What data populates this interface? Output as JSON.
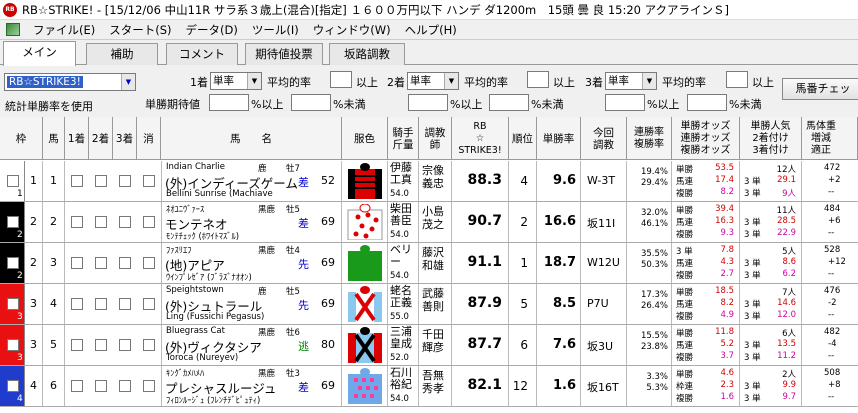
{
  "title": "RB☆STRIKE! - [15/12/06 中山11R サラ系３歳上(混合)[指定] １６００万円以下 ハンデ ダ1200m　15頭 曇 良 15:20 アクアラインＳ]",
  "menu": [
    "ファイル(E)",
    "スタート(S)",
    "データ(D)",
    "ツール(I)",
    "ウィンドウ(W)",
    "ヘルプ(H)"
  ],
  "tabs": [
    "メイン",
    "補助",
    "コメント",
    "期待値投票",
    "坂路調教"
  ],
  "controls": {
    "mode_combo": "RB☆STRIKE3!",
    "stat_label": "統計単勝率を使用",
    "exp_label": "単勝期待値",
    "pct_above": "%以上",
    "pct_below": "%未満",
    "groups": [
      {
        "rank": "1着",
        "type": "単率",
        "avg": "平均的率",
        "cmp": "以上"
      },
      {
        "rank": "2着",
        "type": "単率",
        "avg": "平均的率",
        "cmp": "以上"
      },
      {
        "rank": "3着",
        "type": "単率",
        "avg": "平均的率",
        "cmp": "以上"
      }
    ],
    "side_button": "馬番チェッ"
  },
  "headers": {
    "waku": "枠",
    "uma": "馬",
    "c1": "1着",
    "c2": "2着",
    "c3": "3着",
    "kesu": "消",
    "name": "馬　　名",
    "fuku": "服色",
    "jockey": "騎手\n斤量",
    "trainer": "調教\n師",
    "rb": "RB\n☆\nSTRIKE3!",
    "rank": "順位",
    "odds": "単勝率",
    "training": "今回\n調教",
    "rates": "連勝率\n複勝率",
    "odds_kind": "単勝オッズ\n連勝オッズ\n複勝オッズ",
    "ninki": "単勝人気\n2着付け\n3着付け",
    "weight": "馬体重\n増減\n適正"
  },
  "horses": [
    {
      "waku": "1",
      "uma": "1",
      "sire": "Indian Charlie",
      "sex": "牡7",
      "region": "鹿",
      "name": "(外)インディーズゲーム",
      "style": "差",
      "wt": "52",
      "dam": "Bellini Sunrise (Machiave",
      "jockey": "伊藤\n工真",
      "jkg": "54.0",
      "trainer": "宗像\n義忠",
      "rb": "88.3",
      "rank": "4",
      "tan": "9.6",
      "train": "W-3T",
      "r1": "19.4%",
      "r2": "29.4%",
      "k1": "単勝",
      "k2": "複勝",
      "o1": "53.5",
      "o2": "17.4",
      "o3": "8.2",
      "p1": "3 単",
      "p2": "3 単",
      "n1": "12人",
      "n2": "29.1",
      "n3": "9人",
      "w1": "472",
      "w2": "+2",
      "w3": "--",
      "kind_mid": "馬連"
    },
    {
      "waku": "2",
      "uma": "2",
      "sire": "ﾈｵﾕﾆｳﾞｧｰｽ",
      "sex": "牡5",
      "region": "黒鹿",
      "name": "モンテネオ",
      "style": "差",
      "wt": "69",
      "dam": "ﾓﾝﾃﾁｪｯｸ (ﾎﾜｲﾄﾏｽﾞﾙ)",
      "jockey": "柴田\n善臣",
      "jkg": "54.0",
      "trainer": "小島\n茂之",
      "rb": "90.7",
      "rank": "2",
      "tan": "16.6",
      "train": "坂11I",
      "r1": "32.0%",
      "r2": "46.1%",
      "k1": "単勝",
      "k2": "複勝",
      "o1": "39.4",
      "o2": "16.3",
      "o3": "9.3",
      "p1": "3 単",
      "p2": "3 単",
      "n1": "11人",
      "n2": "28.5",
      "n3": "22.9",
      "w1": "484",
      "w2": "+6",
      "w3": "--",
      "kind_mid": "馬連"
    },
    {
      "waku": "2",
      "uma": "3",
      "sire": "ﾌｧｽﾘｴﾌ",
      "sex": "牡4",
      "region": "黒鹿",
      "name": "(地)アピア",
      "style": "先",
      "wt": "69",
      "dam": "ｳｲﾝﾌﾟﾚｾﾞｱ (ﾌﾞﾗｽﾞﾅｵｵﾝ)",
      "jockey": "ベリ\nー",
      "jkg": "54.0",
      "trainer": "藤沢\n和雄",
      "rb": "91.1",
      "rank": "1",
      "tan": "18.7",
      "train": "W12U",
      "r1": "35.5%",
      "r2": "50.3%",
      "k1": "3 単",
      "k2": "複勝",
      "o1": "7.8",
      "o2": "4.3",
      "o3": "2.7",
      "p1": "3 単",
      "p2": "3 単",
      "n1": "5人",
      "n2": "8.6",
      "n3": "6.2",
      "w1": "528",
      "w2": "+12",
      "w3": "--",
      "kind_mid": "馬連"
    },
    {
      "waku": "3",
      "uma": "4",
      "sire": "Speightstown",
      "sex": "牡5",
      "region": "鹿",
      "name": "(外)シュトラール",
      "style": "先",
      "wt": "69",
      "dam": "Ling (Fussichi Pegasus)",
      "jockey": "蛯名\n正義",
      "jkg": "55.0",
      "trainer": "武藤\n善則",
      "rb": "87.9",
      "rank": "5",
      "tan": "8.5",
      "train": "P7U",
      "r1": "17.3%",
      "r2": "26.4%",
      "k1": "単勝",
      "k2": "複勝",
      "o1": "18.5",
      "o2": "8.2",
      "o3": "4.9",
      "p1": "3 単",
      "p2": "3 単",
      "n1": "7人",
      "n2": "14.6",
      "n3": "12.0",
      "w1": "476",
      "w2": "-2",
      "w3": "--",
      "kind_mid": "馬連"
    },
    {
      "waku": "3",
      "uma": "5",
      "sire": "Bluegrass Cat",
      "sex": "牡6",
      "region": "黒鹿",
      "name": "(外)ヴィクタシア",
      "style": "逃",
      "wt": "80",
      "dam": "Toroca (Nureyev)",
      "jockey": "三浦\n皇成",
      "jkg": "52.0",
      "trainer": "千田\n輝彦",
      "rb": "87.7",
      "rank": "6",
      "tan": "7.6",
      "train": "坂3U",
      "r1": "15.5%",
      "r2": "23.8%",
      "k1": "単勝",
      "k2": "複勝",
      "o1": "11.8",
      "o2": "5.2",
      "o3": "3.7",
      "p1": "3 単",
      "p2": "3 単",
      "n1": "6人",
      "n2": "13.5",
      "n3": "11.2",
      "w1": "482",
      "w2": "-4",
      "w3": "--",
      "kind_mid": "馬連"
    },
    {
      "waku": "4",
      "uma": "6",
      "sire": "ｷﾝｸﾞｶﾒﾊﾒﾊ",
      "sex": "牡3",
      "region": "黒鹿",
      "name": "プレシャスルージュ",
      "style": "差",
      "wt": "69",
      "dam": "ﾌｨﾛﾝﾙｰｼﾞｭ (ﾌﾚﾝﾁﾃﾞﾋﾟｭﾃｨ)",
      "jockey": "石川\n裕紀",
      "jkg": "54.0",
      "trainer": "吾無\n秀孝",
      "rb": "82.1",
      "rank": "12",
      "tan": "1.6",
      "train": "坂16T",
      "r1": "3.3%",
      "r2": "5.3%",
      "k1": "単勝",
      "k2": "複勝",
      "o1": "4.6",
      "o2": "2.3",
      "o3": "1.6",
      "p1": "3 単",
      "p2": "3 単",
      "n1": "2人",
      "n2": "9.9",
      "n3": "9.7",
      "w1": "508",
      "w2": "+8",
      "w3": "--",
      "kind_mid": "枠連"
    }
  ]
}
